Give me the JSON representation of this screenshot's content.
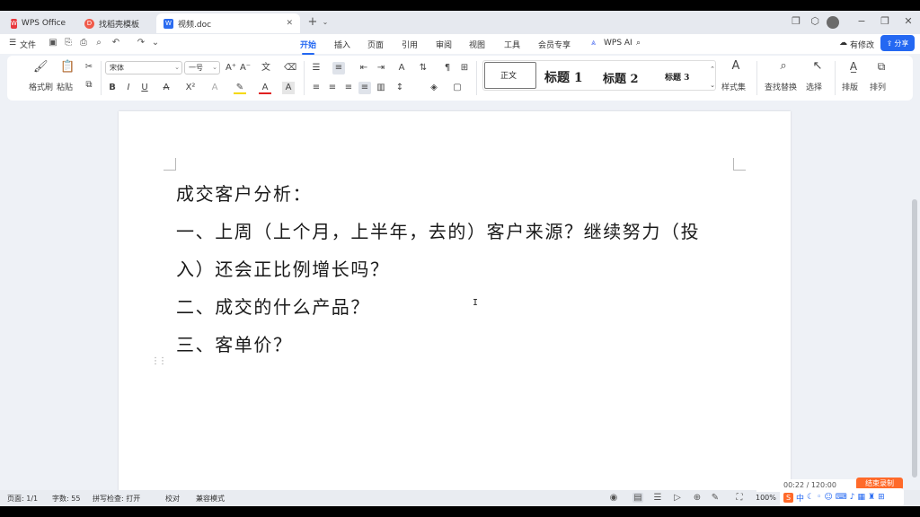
{
  "tabs": [
    {
      "label": "WPS Office",
      "icon": "wps-logo-icon"
    },
    {
      "label": "找稻壳模板",
      "icon": "docer-icon"
    },
    {
      "label": "视频.doc",
      "icon": "word-doc-icon"
    }
  ],
  "menu": {
    "file": "文件",
    "items": [
      "开始",
      "插入",
      "页面",
      "引用",
      "审阅",
      "视图",
      "工具",
      "会员专享"
    ],
    "wps_ai": "WPS AI",
    "modified": "有修改",
    "share": "分享"
  },
  "ribbon": {
    "format_painter": "格式刷",
    "paste": "粘贴",
    "font_name": "宋体",
    "font_size": "一号",
    "styles": [
      "正文",
      "标题 1",
      "标题 2",
      "标题 3"
    ],
    "style_set": "样式集",
    "find_replace": "查找替换",
    "select": "选择",
    "layout": "排版",
    "arrange": "排列"
  },
  "document": {
    "lines": [
      "成交客户分析：",
      "一、上周（上个月，上半年，去的）客户来源？继续努力（投",
      "入）还会正比例增长吗？",
      "二、成交的什么产品？",
      "三、客单价？"
    ]
  },
  "status": {
    "page": "页面: 1/1",
    "words": "字数: 55",
    "spell": "拼写检查: 打开",
    "proofread": "校对",
    "compat": "兼容模式",
    "zoom": "100%"
  },
  "overlay": {
    "time": "00:22 / 120:00",
    "end_button": "结束录制"
  },
  "colors": {
    "accent": "#2468f2",
    "wps_red": "#e8383d",
    "orange": "#ff6a2a"
  }
}
